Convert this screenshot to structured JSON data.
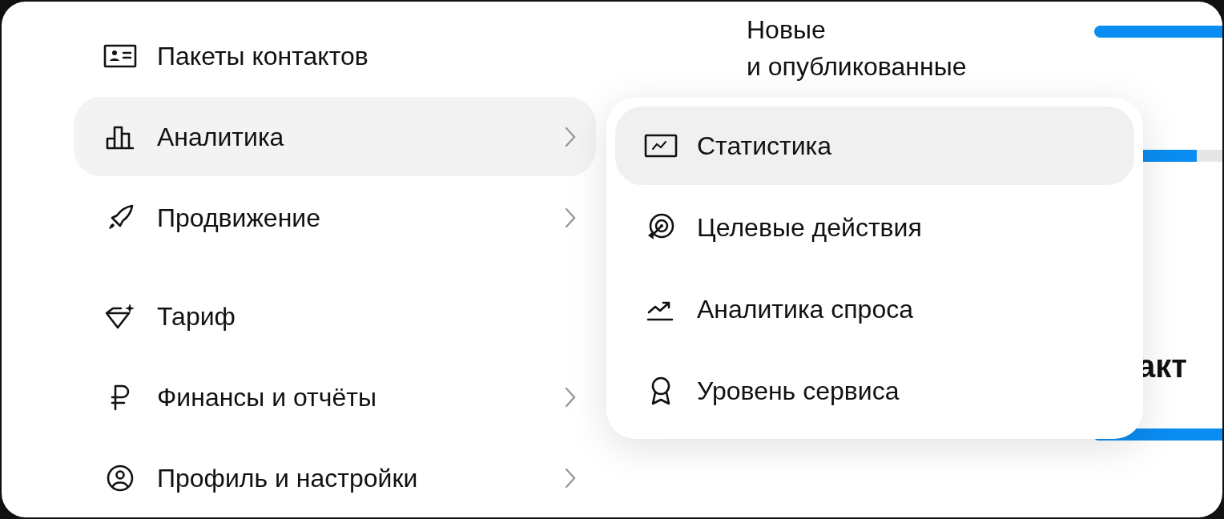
{
  "sidebar": {
    "items": [
      {
        "label": "Пакеты контактов",
        "selected": false,
        "has_submenu": false
      },
      {
        "label": "Аналитика",
        "selected": true,
        "has_submenu": true
      },
      {
        "label": "Продвижение",
        "selected": false,
        "has_submenu": true
      },
      {
        "label": "Тариф",
        "selected": false,
        "has_submenu": false
      },
      {
        "label": "Финансы и отчёты",
        "selected": false,
        "has_submenu": true
      },
      {
        "label": "Профиль и настройки",
        "selected": false,
        "has_submenu": true
      }
    ]
  },
  "submenu": {
    "items": [
      {
        "label": "Статистика",
        "selected": true
      },
      {
        "label": "Целевые действия",
        "selected": false
      },
      {
        "label": "Аналитика спроса",
        "selected": false
      },
      {
        "label": "Уровень сервиса",
        "selected": false
      }
    ]
  },
  "content": {
    "card_title_lines": [
      "Новые",
      "и опубликованные"
    ],
    "heading": "акт",
    "bars": [
      {
        "level": 1
      },
      {
        "level": 0.35
      },
      {
        "level": 1
      }
    ]
  }
}
